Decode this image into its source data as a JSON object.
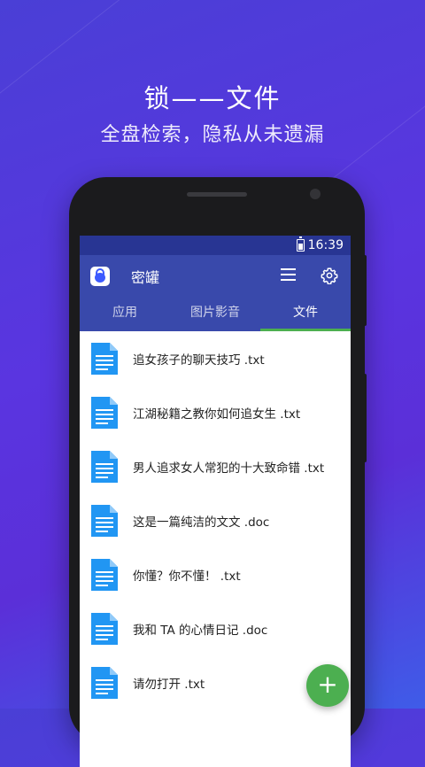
{
  "promo": {
    "headline": "锁——文件",
    "subline": "全盘检索，隐私从未遗漏"
  },
  "status_bar": {
    "time": "16:39",
    "battery_icon": "battery-icon"
  },
  "app_bar": {
    "title": "密罐",
    "logo_icon": "app-lock-logo",
    "menu_icon": "menu-icon",
    "settings_icon": "gear-icon"
  },
  "tabs": [
    {
      "label": "应用",
      "active": false
    },
    {
      "label": "图片影音",
      "active": false
    },
    {
      "label": "文件",
      "active": true
    }
  ],
  "files": [
    {
      "name": "追女孩子的聊天技巧 .txt",
      "icon": "document-icon"
    },
    {
      "name": "江湖秘籍之教你如何追女生 .txt",
      "icon": "document-icon"
    },
    {
      "name": "男人追求女人常犯的十大致命错 .txt",
      "icon": "document-icon"
    },
    {
      "name": "这是一篇纯洁的文文 .doc",
      "icon": "document-icon"
    },
    {
      "name": "你懂？你不懂！ .txt",
      "icon": "document-icon"
    },
    {
      "name": "我和 TA 的心情日记 .doc",
      "icon": "document-icon"
    },
    {
      "name": "请勿打开 .txt",
      "icon": "document-icon"
    }
  ],
  "fab": {
    "label": "+",
    "icon": "add-icon"
  },
  "colors": {
    "app_bar": "#3949ab",
    "status_bar": "#283593",
    "tab_indicator": "#4caf50",
    "doc_icon": "#2196f3",
    "fab": "#4caf50"
  }
}
